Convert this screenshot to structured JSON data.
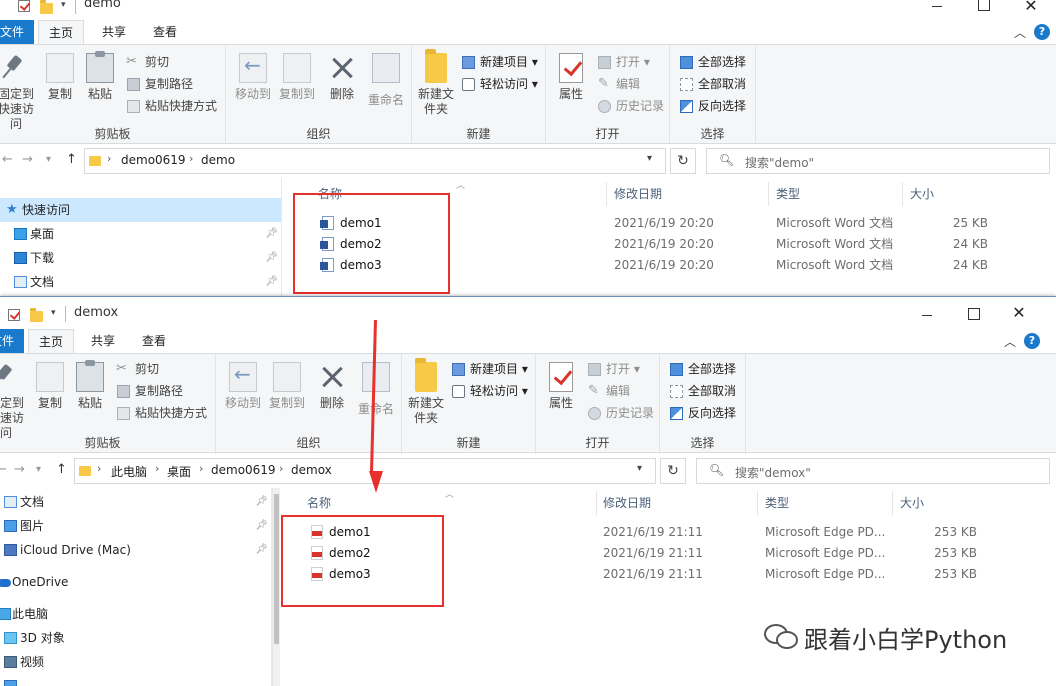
{
  "top_window": {
    "title": "demo",
    "tabs": [
      "文件",
      "主页",
      "共享",
      "查看"
    ],
    "ribbon": {
      "clipboard": {
        "pin": "固定到快速访问",
        "copy": "复制",
        "paste": "粘贴",
        "cut": "剪切",
        "copy_path": "复制路径",
        "paste_shortcut": "粘贴快捷方式",
        "label": "剪贴板"
      },
      "organize": {
        "move_to": "移动到",
        "copy_to": "复制到",
        "delete": "删除",
        "rename": "重命名",
        "label": "组织"
      },
      "new": {
        "new_folder": "新建文件夹",
        "new_item": "新建项目",
        "easy_access": "轻松访问",
        "label": "新建"
      },
      "open": {
        "properties": "属性",
        "open": "打开",
        "edit": "编辑",
        "history": "历史记录",
        "label": "打开"
      },
      "select": {
        "select_all": "全部选择",
        "select_none": "全部取消",
        "invert": "反向选择",
        "label": "选择"
      }
    },
    "address": {
      "crumbs": [
        "demo0619",
        "demo"
      ],
      "search_placeholder": "搜索\"demo\""
    },
    "nav": [
      {
        "label": "快速访问"
      },
      {
        "label": "桌面"
      },
      {
        "label": "下载"
      },
      {
        "label": "文档"
      }
    ],
    "columns": [
      "名称",
      "修改日期",
      "类型",
      "大小"
    ],
    "files": [
      {
        "name": "demo1",
        "date": "2021/6/19 20:20",
        "type": "Microsoft Word 文档",
        "size": "25 KB"
      },
      {
        "name": "demo2",
        "date": "2021/6/19 20:20",
        "type": "Microsoft Word 文档",
        "size": "24 KB"
      },
      {
        "name": "demo3",
        "date": "2021/6/19 20:20",
        "type": "Microsoft Word 文档",
        "size": "24 KB"
      }
    ]
  },
  "bottom_window": {
    "title": "demox",
    "tabs": [
      "文件",
      "主页",
      "共享",
      "查看"
    ],
    "ribbon": {
      "clipboard": {
        "pin": "固定到快速访问",
        "copy": "复制",
        "paste": "粘贴",
        "cut": "剪切",
        "copy_path": "复制路径",
        "paste_shortcut": "粘贴快捷方式",
        "label": "剪贴板"
      },
      "organize": {
        "move_to": "移动到",
        "copy_to": "复制到",
        "delete": "删除",
        "rename": "重命名",
        "label": "组织"
      },
      "new": {
        "new_folder": "新建文件夹",
        "new_item": "新建项目",
        "easy_access": "轻松访问",
        "label": "新建"
      },
      "open": {
        "properties": "属性",
        "open": "打开",
        "edit": "编辑",
        "history": "历史记录",
        "label": "打开"
      },
      "select": {
        "select_all": "全部选择",
        "select_none": "全部取消",
        "invert": "反向选择",
        "label": "选择"
      }
    },
    "address": {
      "crumbs": [
        "此电脑",
        "桌面",
        "demo0619",
        "demox"
      ],
      "search_placeholder": "搜索\"demox\""
    },
    "nav": [
      {
        "label": "文档"
      },
      {
        "label": "图片"
      },
      {
        "label": "iCloud Drive (Mac)"
      },
      {
        "label": "OneDrive"
      },
      {
        "label": "此电脑"
      },
      {
        "label": "3D 对象"
      },
      {
        "label": "视频"
      }
    ],
    "columns": [
      "名称",
      "修改日期",
      "类型",
      "大小"
    ],
    "files": [
      {
        "name": "demo1",
        "date": "2021/6/19 21:11",
        "type": "Microsoft Edge PD...",
        "size": "253 KB"
      },
      {
        "name": "demo2",
        "date": "2021/6/19 21:11",
        "type": "Microsoft Edge PD...",
        "size": "253 KB"
      },
      {
        "name": "demo3",
        "date": "2021/6/19 21:11",
        "type": "Microsoft Edge PD...",
        "size": "253 KB"
      }
    ]
  },
  "watermark": {
    "text": "跟着小白学Python"
  },
  "colors": {
    "file_tab": "#1979ca",
    "selection": "#cce8ff",
    "annotation_red": "#e8312c"
  }
}
